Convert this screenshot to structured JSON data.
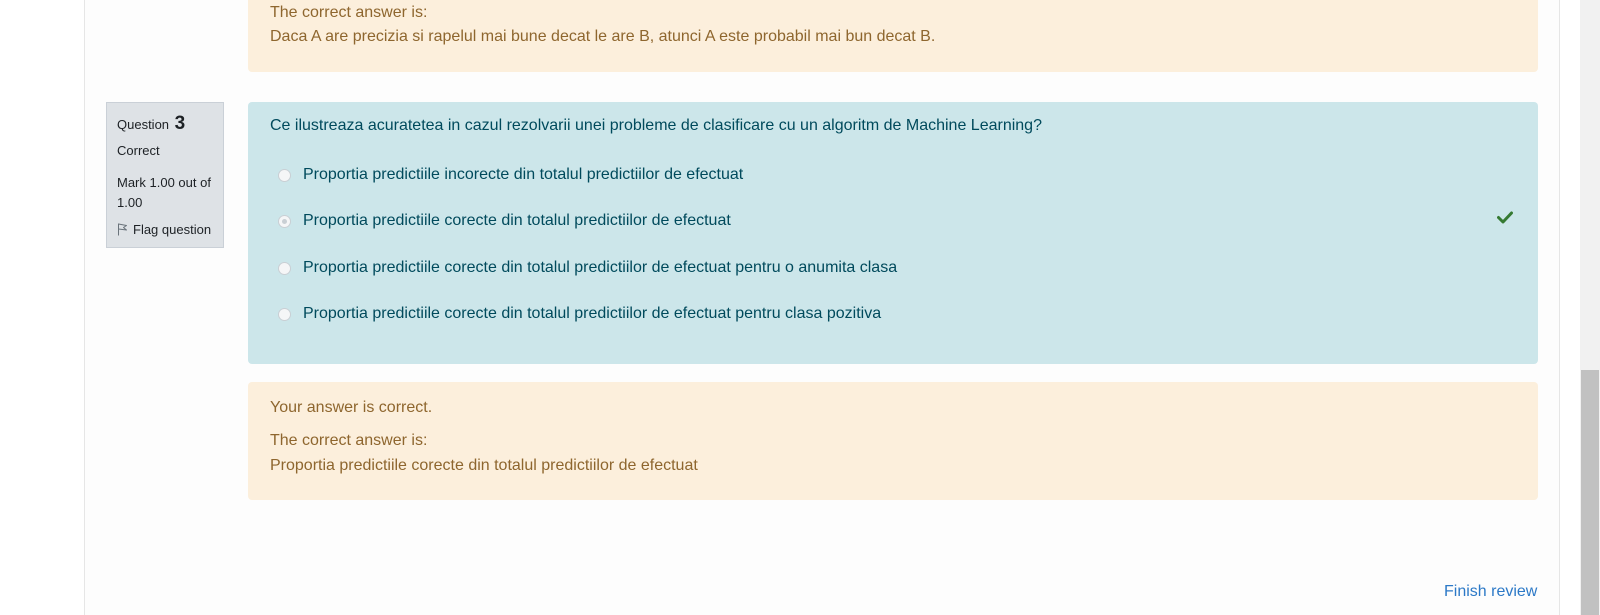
{
  "previous_feedback": {
    "correct_answer_label": "The correct answer is:",
    "correct_answer_text": "Daca A are precizia si rapelul mai bune decat le are B, atunci A este probabil mai bun decat B."
  },
  "question_info": {
    "question_label": "Question",
    "question_number": "3",
    "state": "Correct",
    "grade": "Mark 1.00 out of 1.00",
    "flag_label": "Flag question"
  },
  "question": {
    "text": "Ce ilustreaza acuratetea in cazul rezolvarii unei probleme de clasificare cu un algoritm de Machine Learning?",
    "answers": [
      {
        "label": "Proportia predictiile incorecte din totalul predictiilor de efectuat",
        "selected": false
      },
      {
        "label": "Proportia predictiile corecte din totalul predictiilor de efectuat",
        "selected": true
      },
      {
        "label": "Proportia predictiile corecte din totalul predictiilor de efectuat pentru o anumita clasa",
        "selected": false
      },
      {
        "label": "Proportia predictiile corecte din totalul predictiilor de efectuat pentru clasa pozitiva",
        "selected": false
      }
    ],
    "correct_icon": "check-icon"
  },
  "feedback": {
    "result": "Your answer is correct.",
    "correct_answer_label": "The correct answer is:",
    "correct_answer_text": "Proportia predictiile corecte din totalul predictiilor de efectuat"
  },
  "footer": {
    "finish_review_label": "Finish review"
  },
  "colors": {
    "feedback_bg": "#fcefdc",
    "feedback_text": "#8e662e",
    "question_bg": "#cce6ea",
    "question_text": "#004a5c",
    "link": "#2c79c7",
    "check": "#357a32"
  }
}
